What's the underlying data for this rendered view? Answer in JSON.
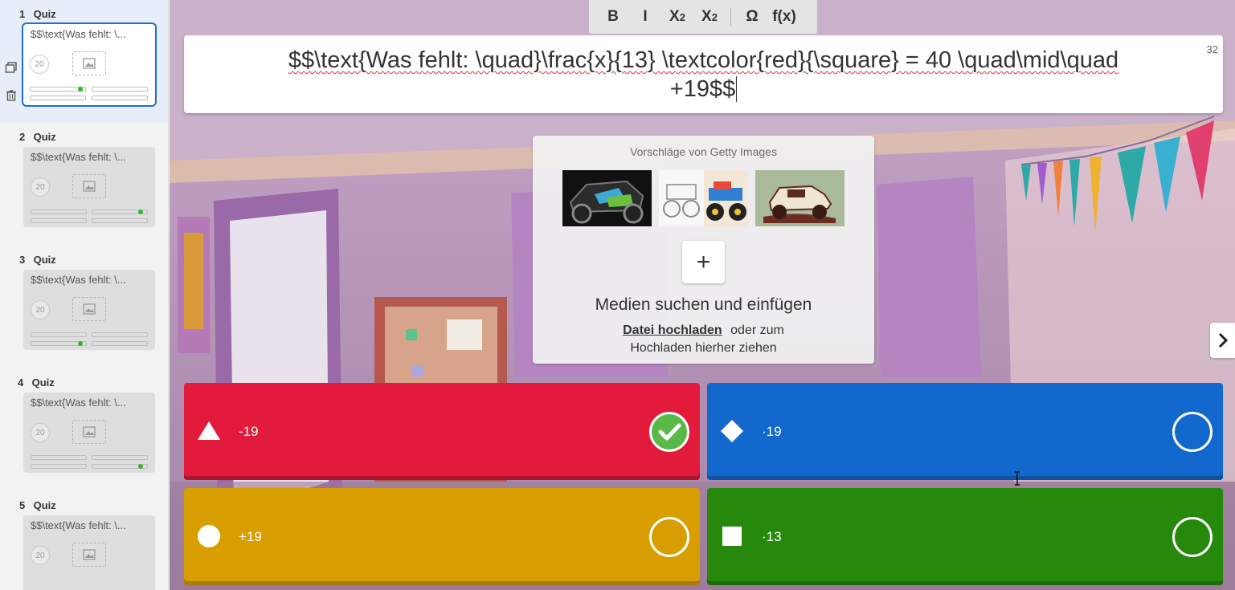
{
  "colors": {
    "accent": "#1f6fd1",
    "answer_red": "#e21b3c",
    "answer_blue": "#1368ce",
    "answer_yellow": "#d89e00",
    "answer_green": "#26890c",
    "correct_green": "#59b948"
  },
  "sidebar": {
    "slides": [
      {
        "number": "1",
        "type": "Quiz",
        "preview": "$$\\text{Was fehlt: \\...",
        "timer": "20",
        "active": true
      },
      {
        "number": "2",
        "type": "Quiz",
        "preview": "$$\\text{Was fehlt: \\...",
        "timer": "20",
        "active": false
      },
      {
        "number": "3",
        "type": "Quiz",
        "preview": "$$\\text{Was fehlt: \\...",
        "timer": "20",
        "active": false
      },
      {
        "number": "4",
        "type": "Quiz",
        "preview": "$$\\text{Was fehlt: \\...",
        "timer": "20",
        "active": false
      },
      {
        "number": "5",
        "type": "Quiz",
        "preview": "$$\\text{Was fehlt: \\...",
        "timer": "20",
        "active": false
      }
    ],
    "icons": [
      "duplicate-icon",
      "trash-icon"
    ]
  },
  "toolbar": {
    "bold": "B",
    "italic": "I",
    "subscript": "X",
    "subscript_sub": "2",
    "superscript": "X",
    "superscript_sup": "2",
    "special_chars": "Ω",
    "formula": "f(x)"
  },
  "question": {
    "text_line1": "$$\\text{Was fehlt: \\quad}\\frac{x}{13} \\textcolor{red}{\\square} = 40 \\quad\\mid\\quad",
    "text_line2": "+19$$",
    "remaining_chars": "32"
  },
  "media": {
    "suggestions_title": "Vorschläge von Getty Images",
    "suggestion_icons": [
      "offroad-buggy-image",
      "monster-truck-image",
      "jeep-image"
    ],
    "add_icon": "+",
    "heading": "Medien suchen und einfügen",
    "upload_link": "Datei hochladen",
    "upload_rest_1": "oder zum",
    "upload_rest_2": "Hochladen hierher ziehen"
  },
  "answers": [
    {
      "shape": "triangle-icon",
      "text": "-19",
      "correct": true
    },
    {
      "shape": "diamond-icon",
      "text": "·19",
      "correct": false
    },
    {
      "shape": "circle-icon",
      "text": "+19",
      "correct": false
    },
    {
      "shape": "square-icon",
      "text": "·13",
      "correct": false
    }
  ]
}
